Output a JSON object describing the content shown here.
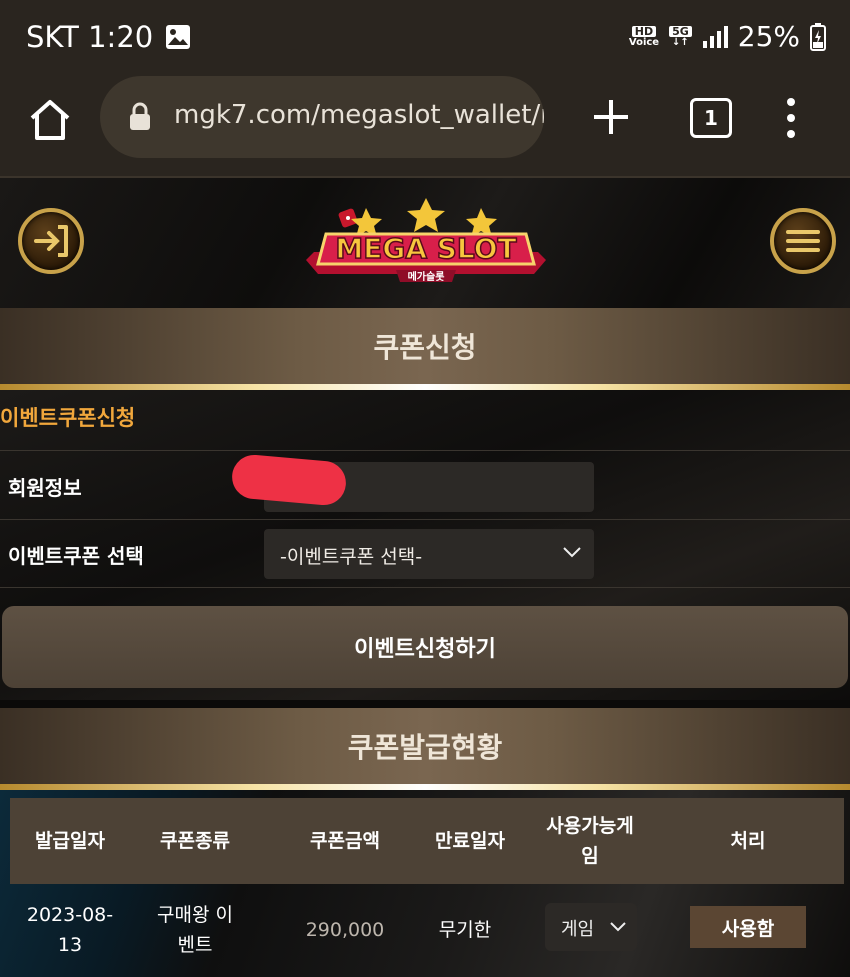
{
  "status_bar": {
    "carrier_time": "SKT 1:20",
    "hd_label": "HD",
    "voice_label": "Voice",
    "network": "5G",
    "battery": "25%"
  },
  "browser": {
    "url": "mgk7.com/megaslot_wallet/m",
    "tab_count": "1"
  },
  "site": {
    "logo_text": "MEGA SLOT",
    "logo_sub": "메가슬롯"
  },
  "coupon_apply": {
    "title": "쿠폰신청",
    "heading": "이벤트쿠폰신청",
    "member_label": "회원정보",
    "coupon_select_label": "이벤트쿠폰 선택",
    "coupon_select_value": "-이벤트쿠폰 선택-",
    "submit_label": "이벤트신청하기"
  },
  "coupon_status": {
    "title": "쿠폰발급현황",
    "columns": [
      "발급일자",
      "쿠폰종류",
      "쿠폰금액",
      "만료일자",
      "사용가능게임",
      "처리"
    ],
    "column_lines": [
      [
        "발급일자"
      ],
      [
        "쿠폰종류"
      ],
      [
        "쿠폰금액"
      ],
      [
        "만료일자"
      ],
      [
        "사용가능게",
        "임"
      ],
      [
        "처리"
      ]
    ],
    "rows": [
      {
        "issue_date": "2023-08-13",
        "issue_date_l1": "2023-08-",
        "issue_date_l2": "13",
        "coupon_type": "구매왕 이벤트",
        "coupon_type_l1": "구매왕 이",
        "coupon_type_l2": "벤트",
        "amount": "290,000",
        "expiry": "무기한",
        "game": "게임",
        "action": "사용함"
      }
    ]
  },
  "colors": {
    "accent_orange": "#f1a73c",
    "bar_brown": "#4d4236",
    "gold": "#c8a24a"
  }
}
